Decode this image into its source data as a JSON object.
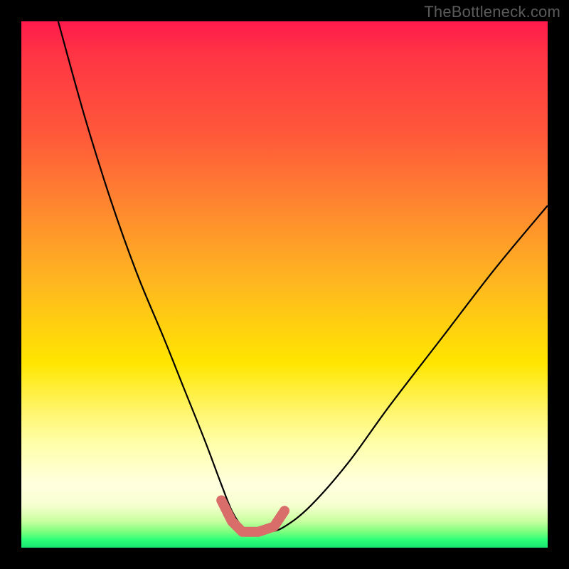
{
  "watermark": "TheBottleneck.com",
  "chart_data": {
    "type": "line",
    "title": "",
    "xlabel": "",
    "ylabel": "",
    "xlim": [
      0,
      100
    ],
    "ylim": [
      0,
      100
    ],
    "background_gradient": {
      "stops": [
        {
          "pos": 0,
          "color": "#ff1a4d"
        },
        {
          "pos": 22,
          "color": "#ff5a3a"
        },
        {
          "pos": 50,
          "color": "#ffb81f"
        },
        {
          "pos": 74,
          "color": "#fff56b"
        },
        {
          "pos": 92,
          "color": "#f6ffcf"
        },
        {
          "pos": 100,
          "color": "#16e66f"
        }
      ]
    },
    "series": [
      {
        "name": "bottleneck-curve",
        "stroke": "#000000",
        "stroke_width": 2,
        "x": [
          7,
          12,
          17,
          22,
          27,
          31,
          35,
          38,
          40,
          42,
          44,
          47,
          50,
          55,
          62,
          70,
          80,
          90,
          100
        ],
        "y": [
          100,
          82,
          66,
          52,
          40,
          30,
          20,
          12,
          7,
          4,
          3,
          3,
          4,
          8,
          16,
          27,
          40,
          53,
          65
        ]
      },
      {
        "name": "highlight-segment",
        "stroke": "#d86d6a",
        "stroke_width": 12,
        "linecap": "round",
        "x": [
          38,
          40,
          42,
          45,
          48,
          50
        ],
        "y": [
          9,
          5,
          3,
          3,
          4,
          7
        ]
      }
    ],
    "annotations": []
  }
}
